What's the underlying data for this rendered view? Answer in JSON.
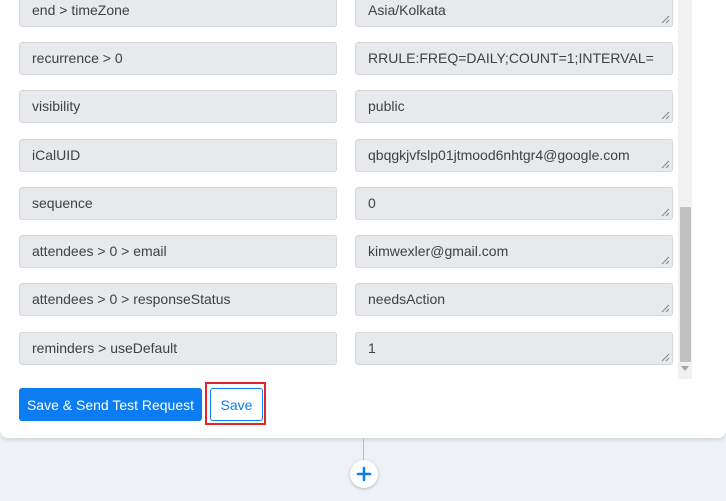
{
  "fields": [
    {
      "label": "end > timeZone",
      "value": "Asia/Kolkata"
    },
    {
      "label": "recurrence > 0",
      "value": "RRULE:FREQ=DAILY;COUNT=1;INTERVAL="
    },
    {
      "label": "visibility",
      "value": "public"
    },
    {
      "label": "iCalUID",
      "value": "qbqgkjvfslp01jtmood6nhtgr4@google.com"
    },
    {
      "label": "sequence",
      "value": "0"
    },
    {
      "label": "attendees > 0 > email",
      "value": "kimwexler@gmail.com"
    },
    {
      "label": "attendees > 0 > responseStatus",
      "value": "needsAction"
    },
    {
      "label": "reminders > useDefault",
      "value": "1"
    }
  ],
  "actions": {
    "send_test_label": "Save & Send Test Request",
    "save_label": "Save"
  },
  "colors": {
    "primary": "#0b7cf1",
    "highlight": "#e3242b"
  },
  "icons": {
    "add_step": "plus-icon",
    "resize": "resize-grip-icon"
  }
}
